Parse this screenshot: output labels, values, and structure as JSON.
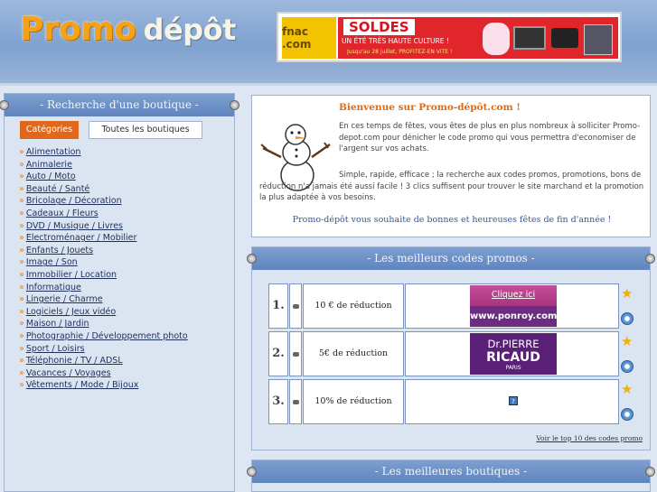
{
  "header": {
    "logo_part1": "Promo",
    "logo_part2": "dépôt"
  },
  "banner": {
    "brand": "fnac .com",
    "headline": "SOLDES",
    "subline": "UN ÉTÉ TRÈS HAUTE CULTURE !",
    "small": "Jusqu'au 28 juillet, PROFITEZ-EN VITE !"
  },
  "sidebar": {
    "title": "- Recherche d'une boutique -",
    "tab_categories": "Catégories",
    "tab_all_shops": "Toutes les boutiques",
    "bullet": "»",
    "categories": [
      "Alimentation",
      "Animalerie",
      "Auto / Moto",
      "Beauté / Santé",
      "Bricolage / Décoration",
      "Cadeaux / Fleurs",
      "DVD / Musique / Livres",
      "Electroménager / Mobilier",
      "Enfants / Jouets",
      "Image / Son",
      "Immobilier / Location",
      "Informatique",
      "Lingerie / Charme",
      "Logiciels / Jeux vidéo",
      "Maison / Jardin",
      "Photographie / Développement photo",
      "Sport / Loisirs",
      "Téléphonie / TV / ADSL",
      "Vacances / Voyages",
      "Vêtements / Mode / Bijoux"
    ]
  },
  "welcome": {
    "title": "Bienvenue sur Promo-dépôt.com !",
    "para1": "En ces temps de fêtes, vous êtes de plus en plus nombreux à solliciter Promo-depot.com pour dénicher le code promo qui vous permettra d'economiser de l'argent sur vos achats.",
    "para2": "Simple, rapide, efficace ; la recherche aux codes promos, promotions, bons de réduction n'a jamais été aussi facile ! 3 clics suffisent pour trouver le site marchand et la promotion la plus adaptée à vos besoins.",
    "para3": "Promo-dépôt vous souhaite de bonnes et heureuses fêtes de fin d'année !"
  },
  "best_codes": {
    "title": "- Les meilleurs codes promos -",
    "rows": [
      {
        "rank": "1.",
        "label": "10 € de réduction",
        "shop_top": "Cliquez ici",
        "shop_bottom": "www.ponroy.com"
      },
      {
        "rank": "2.",
        "label": "5€ de réduction",
        "shop_line1": "Dr.PIERRE",
        "shop_line2": "RICAUD",
        "shop_line3": "PARIS"
      },
      {
        "rank": "3.",
        "label": "10% de réduction",
        "shop_placeholder": "?"
      }
    ],
    "star_glyph": "★",
    "more_link": "Voir le top 10 des codes promo"
  },
  "best_shops": {
    "title": "- Les meilleures boutiques -"
  },
  "colors": {
    "accent_orange": "#e0681c",
    "bar_blue": "#6b8fc8",
    "link_blue": "#2f58a3"
  }
}
